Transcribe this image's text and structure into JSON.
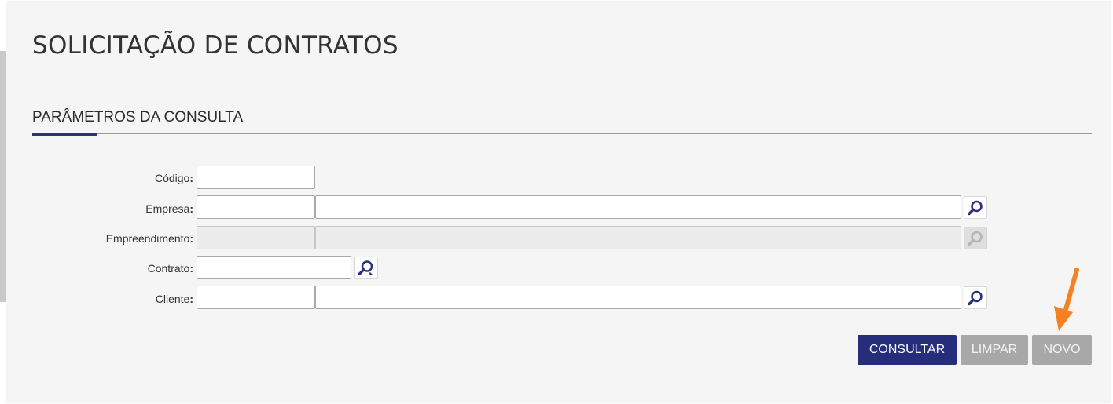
{
  "page": {
    "title": "SOLICITAÇÃO DE CONTRATOS"
  },
  "section": {
    "title": "PARÂMETROS DA CONSULTA"
  },
  "form": {
    "codigo": {
      "label": "Código",
      "value": ""
    },
    "empresa": {
      "label": "Empresa",
      "code_value": "",
      "name_value": ""
    },
    "empreendimento": {
      "label": "Empreendimento",
      "code_value": "",
      "name_value": "",
      "disabled": true
    },
    "contrato": {
      "label": "Contrato",
      "value": ""
    },
    "cliente": {
      "label": "Cliente",
      "code_value": "",
      "name_value": ""
    },
    "colon": ":"
  },
  "icons": {
    "lookup": "magnifier-icon",
    "contract_lookup": "magnifier-refresh-icon",
    "annotation": "orange-arrow-icon"
  },
  "actions": {
    "consultar": "CONSULTAR",
    "limpar": "LIMPAR",
    "novo": "NOVO"
  },
  "colors": {
    "primary": "#262d7a",
    "accent_underline": "#2b327d",
    "button_disabled": "#a8a8a8",
    "annotation": "#f58220"
  }
}
